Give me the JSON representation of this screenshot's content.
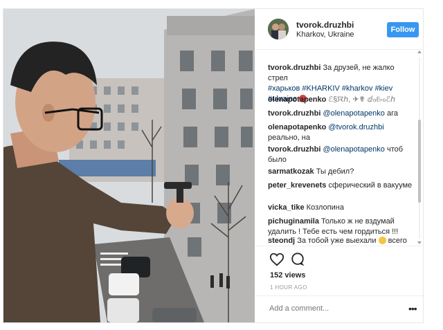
{
  "post": {
    "username": "tvorok.druzhbi",
    "location": "Kharkov, Ukraine",
    "follow_label": "Follow",
    "views": "152 views",
    "timestamp": "1 HOUR AGO",
    "comment_placeholder": "Add a comment...",
    "more_label": "•••"
  },
  "comments": [
    {
      "user": "tvorok.druzhbi",
      "text": "За друзей, не жалко стрел",
      "tags": "#харьков #KHARKIV #kharkov #kiev #ukraine"
    },
    {
      "user": "olenapotapenko",
      "text": "ℰ§ꯋℎ, ✈✟ ⅆℴℓ♭ℴℰℎ"
    },
    {
      "user": "tvorok.druzhbi",
      "mention": "@olenapotapenko",
      "text": "ага"
    },
    {
      "user": "olenapotapenko",
      "mention": "@tvorok.druzhbi",
      "text": "реально, на"
    },
    {
      "user": "tvorok.druzhbi",
      "mention": "@olenapotapenko",
      "text": "чтоб было"
    },
    {
      "user": "sarmatkozak",
      "text": "Ты дебил?"
    },
    {
      "user": "peter_krevenets",
      "text": "сферический в вакууме"
    },
    {
      "user": "vicka_tike",
      "text": "Козлопина"
    },
    {
      "user": "pichuginamila",
      "text": "Только ж не вздумай удалить ! Тебе есть чем гордиться !!!"
    },
    {
      "user": "steondj",
      "text": "За тобой уже выехали",
      "text2": "всего хорошего!"
    }
  ],
  "icons": {
    "like": "heart-icon",
    "comment": "comment-bubble-icon",
    "options": "more-options-icon"
  },
  "colors": {
    "follow_bg": "#3897f0",
    "tag": "#003569",
    "muted": "#999999"
  }
}
